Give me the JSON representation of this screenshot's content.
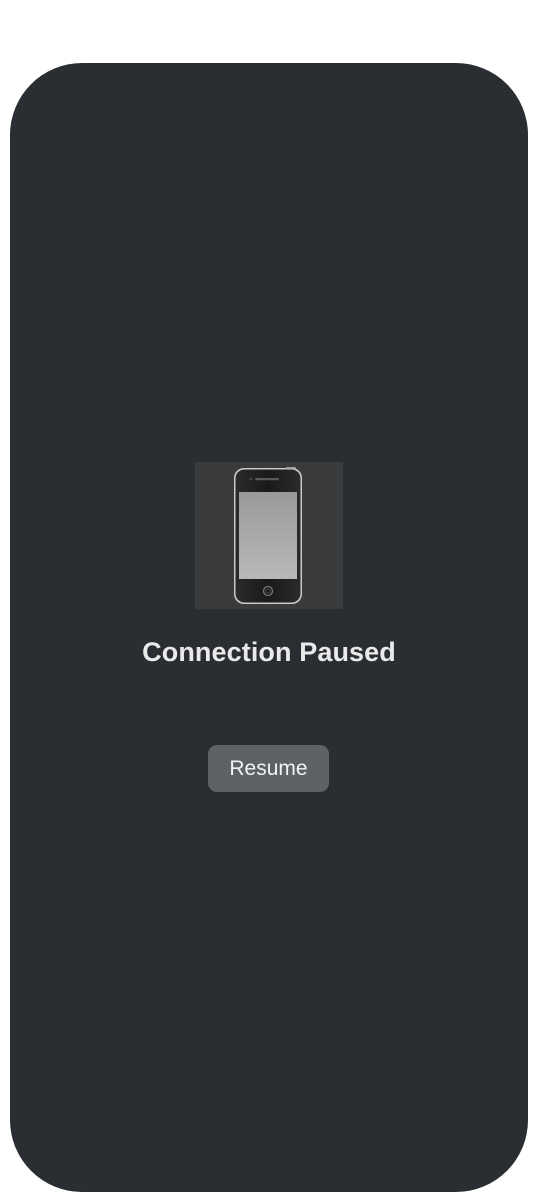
{
  "status": {
    "title": "Connection Paused"
  },
  "actions": {
    "resume_label": "Resume"
  },
  "device": {
    "icon": "iphone-icon"
  },
  "colors": {
    "frame_background": "#2a2d31",
    "thumb_background": "#3a3b3d",
    "button_background": "#5e6266",
    "title_text": "#eaeaea"
  }
}
